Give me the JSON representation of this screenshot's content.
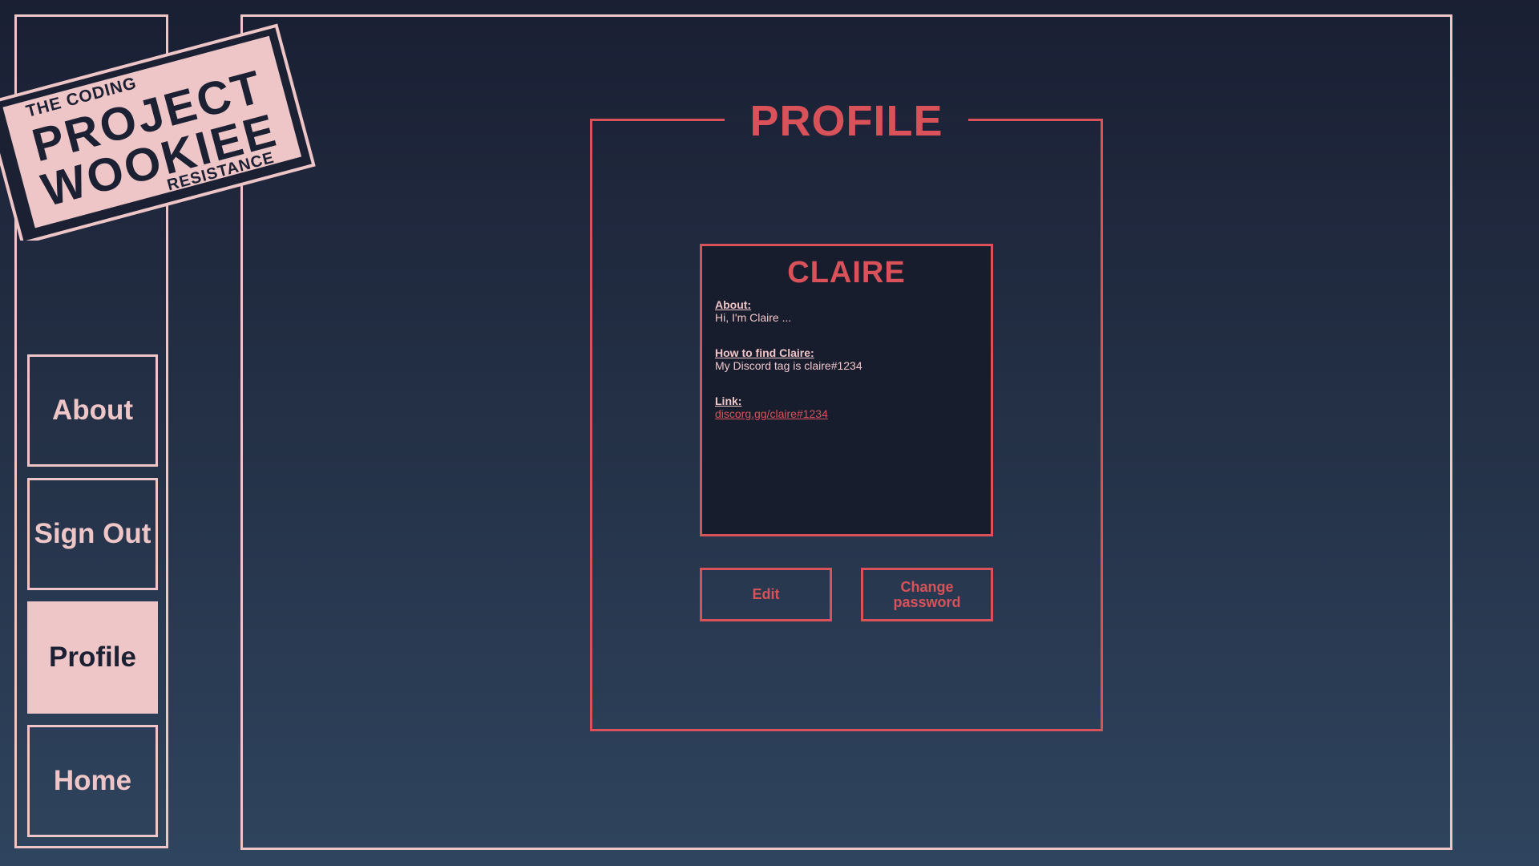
{
  "logo": {
    "top_text": "THE CODING",
    "line1": "PROJECT",
    "line2": "WOOKIEE",
    "bottom_text": "RESISTANCE"
  },
  "nav": {
    "items": [
      {
        "label": "About",
        "active": false
      },
      {
        "label": "Sign Out",
        "active": false
      },
      {
        "label": "Profile",
        "active": true
      },
      {
        "label": "Home",
        "active": false
      }
    ]
  },
  "page": {
    "title": "PROFILE"
  },
  "profile": {
    "name": "CLAIRE",
    "about_label": "About:",
    "about_value": "Hi, I'm Claire ...",
    "find_label": "How to find Claire:",
    "find_value": "My Discord tag is claire#1234",
    "link_label": "Link:",
    "link_value": "discorg.gg/claire#1234"
  },
  "actions": {
    "edit_label": "Edit",
    "change_password_label": "Change\npassword"
  },
  "colors": {
    "accent_pink": "#efc6c8",
    "accent_red": "#d9525a",
    "dark": "#1b2033"
  }
}
